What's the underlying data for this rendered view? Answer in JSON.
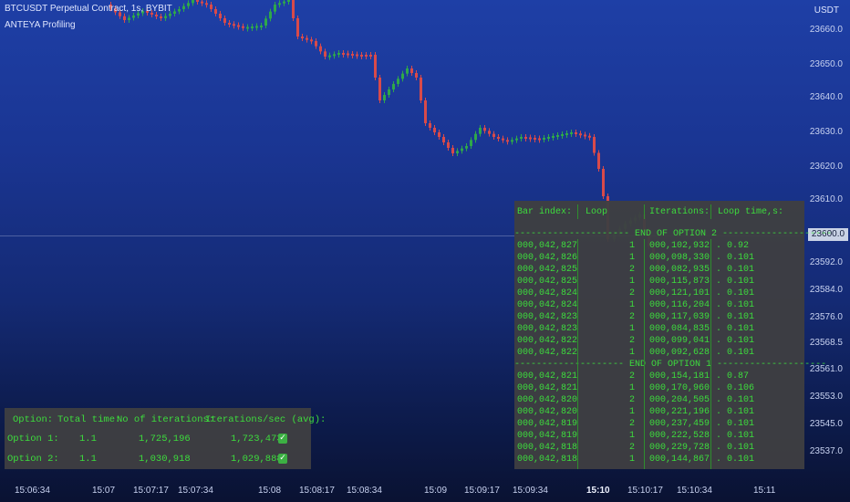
{
  "header": {
    "symbol_line": "BTCUSDT Perpetual Contract, 1s, BYBIT",
    "indicator_line": "ANTEYA Profiling"
  },
  "price_axis": {
    "currency": "USDT",
    "current_price": "23600.0",
    "labels": [
      "23660.0",
      "23650.0",
      "23640.0",
      "23630.0",
      "23620.0",
      "23610.0",
      "23592.0",
      "23584.0",
      "23576.0",
      "23568.5",
      "23561.0",
      "23553.0",
      "23545.0",
      "23537.0"
    ]
  },
  "time_axis": {
    "labels": [
      "15:06:34",
      "15:07",
      "15:07:17",
      "15:07:34",
      "15:08",
      "15:08:17",
      "15:08:34",
      "15:09",
      "15:09:17",
      "15:09:34",
      "15:10",
      "15:10:17",
      "15:10:34",
      "15:11"
    ],
    "emphasized": "15:10"
  },
  "summary_table": {
    "headers": [
      "Option:",
      "Total time:",
      "No of iterations:",
      "Iterations/sec (avg):"
    ],
    "rows": [
      {
        "option": "Option 1:",
        "total_time": "1.1",
        "iterations": "1,725,196",
        "rate": "1,723,473"
      },
      {
        "option": "Option 2:",
        "total_time": "1.1",
        "iterations": "1,030,918",
        "rate": "1,029,888"
      }
    ]
  },
  "log_table": {
    "headers": {
      "bar_index": "Bar index:",
      "loop": "Loop",
      "iterations": "Iterations:",
      "loop_time": "Loop time,s:"
    },
    "end_option_2_label": "END OF OPTION 2",
    "end_option_1_label": "END OF OPTION 1",
    "option2_rows": [
      {
        "bar": "000,042,827",
        "loop": "1",
        "iter": "000,102,932",
        "time": ". 0.92"
      },
      {
        "bar": "000,042,826",
        "loop": "1",
        "iter": "000,098,330",
        "time": ". 0.101"
      },
      {
        "bar": "000,042,825",
        "loop": "2",
        "iter": "000,082,935",
        "time": ". 0.101"
      },
      {
        "bar": "000,042,825",
        "loop": "1",
        "iter": "000,115,873",
        "time": ". 0.101"
      },
      {
        "bar": "000,042,824",
        "loop": "2",
        "iter": "000,121,101",
        "time": ". 0.101"
      },
      {
        "bar": "000,042,824",
        "loop": "1",
        "iter": "000,116,204",
        "time": ". 0.101"
      },
      {
        "bar": "000,042,823",
        "loop": "2",
        "iter": "000,117,039",
        "time": ". 0.101"
      },
      {
        "bar": "000,042,823",
        "loop": "1",
        "iter": "000,084,835",
        "time": ". 0.101"
      },
      {
        "bar": "000,042,822",
        "loop": "2",
        "iter": "000,099,041",
        "time": ". 0.101"
      },
      {
        "bar": "000,042,822",
        "loop": "1",
        "iter": "000,092,628",
        "time": ". 0.101"
      }
    ],
    "option1_rows": [
      {
        "bar": "000,042,821",
        "loop": "2",
        "iter": "000,154,181",
        "time": ". 0.87"
      },
      {
        "bar": "000,042,821",
        "loop": "1",
        "iter": "000,170,960",
        "time": ". 0.106"
      },
      {
        "bar": "000,042,820",
        "loop": "2",
        "iter": "000,204,505",
        "time": ". 0.101"
      },
      {
        "bar": "000,042,820",
        "loop": "1",
        "iter": "000,221,196",
        "time": ". 0.101"
      },
      {
        "bar": "000,042,819",
        "loop": "2",
        "iter": "000,237,459",
        "time": ". 0.101"
      },
      {
        "bar": "000,042,819",
        "loop": "1",
        "iter": "000,222,528",
        "time": ". 0.101"
      },
      {
        "bar": "000,042,818",
        "loop": "2",
        "iter": "000,229,728",
        "time": ". 0.101"
      },
      {
        "bar": "000,042,818",
        "loop": "1",
        "iter": "000,144,867",
        "time": ". 0.101"
      }
    ]
  },
  "colors": {
    "up": "#2ea84a",
    "down": "#d84a4a",
    "table_text": "#3ddc3d",
    "table_bg": "#3e3e42"
  },
  "icons": {
    "check": "check-icon"
  }
}
